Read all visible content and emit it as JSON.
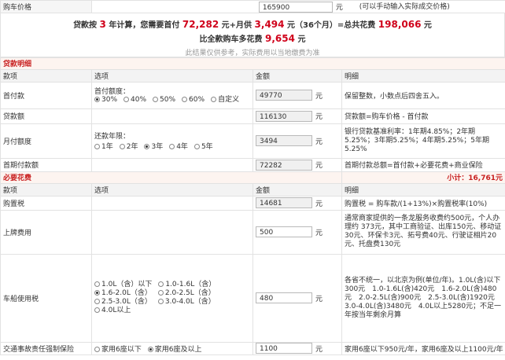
{
  "car_price": {
    "label": "购车价格",
    "value": "165900",
    "unit": "元",
    "hint": "(可以手动输入实际成交价格)"
  },
  "summary": {
    "line1_prefix": "贷款按",
    "years": "3",
    "line1_mid": "年计算，您需要首付",
    "down": "72,282",
    "unit1": "元+月供",
    "monthly": "3,494",
    "unit2": "元（36个月）=总共花费",
    "total": "198,066",
    "unit3": "元",
    "line2_prefix": "比全款购车多花费",
    "extra": "9,654",
    "unit4": "元",
    "note": "此结果仅供参考，实际费用以当地缴费为准"
  },
  "loan_section": {
    "title": "贷款明细"
  },
  "cols": {
    "item": "款项",
    "option": "选项",
    "amount": "金额",
    "detail": "明细"
  },
  "loan_rows": [
    {
      "name": "首付款",
      "option_title": "首付额度：",
      "options": [
        "30%",
        "40%",
        "50%",
        "60%",
        "自定义"
      ],
      "selected": 0,
      "value": "49770",
      "unit": "元",
      "detail": "保留整数，小数点后四舍五入。"
    },
    {
      "name": "贷款额",
      "value": "116130",
      "unit": "元",
      "detail": "贷款额=购车价格 - 首付款"
    },
    {
      "name": "月付额度",
      "option_title": "还款年限：",
      "options": [
        "1年",
        "2年",
        "3年",
        "4年",
        "5年"
      ],
      "selected": 2,
      "value": "3494",
      "unit": "元",
      "detail": "银行贷款基准利率：1年期4.85%；2年期5.25%；3年期5.25%；4年期5.25%；5年期5.25%"
    },
    {
      "name": "首期付款额",
      "value": "72282",
      "unit": "元",
      "detail": "首期付款总额=首付款+必要花费+商业保险"
    }
  ],
  "required_section": {
    "title": "必要花费",
    "subtotal_label": "小计：",
    "subtotal": "16,761元"
  },
  "required_rows": [
    {
      "name": "购置税",
      "value": "14681",
      "unit": "元",
      "detail": "购置税 = 购车款/(1+13%)×购置税率(10%)"
    },
    {
      "name": "上牌费用",
      "value": "500",
      "unit": "元",
      "detail": "通常商家提供的一条龙服务收费约500元，个人办理约 373元，其中工商验证、出库150元、移动证30元、环保卡3元、拓号费40元、行驶证相片20元、托盘费130元"
    },
    {
      "name": "车船使用税",
      "options": [
        "1.0L（含）以下",
        "1.0-1.6L（含）",
        "1.6-2.0L（含）",
        "2.0-2.5L（含）",
        "2.5-3.0L（含）",
        "3.0-4.0L（含）",
        "4.0L以上"
      ],
      "selected": 2,
      "value": "480",
      "unit": "元",
      "detail": "各省不统一，以北京为例(单位/年)。1.0L(含)以下300元　1.0-1.6L(含)420元　1.6-2.0L(含)480元　2.0-2.5L(含)900元　2.5-3.0L(含)1920元　3.0-4.0L(含)3480元　4.0L以上5280元；不足一年按当年剩余月算"
    },
    {
      "name": "交通事故责任强制保险",
      "options": [
        "家用6座以下",
        "家用6座及以上"
      ],
      "selected": 1,
      "value": "1100",
      "unit": "元",
      "detail": "家用6座以下950元/年，家用6座及以上1100元/年"
    }
  ]
}
